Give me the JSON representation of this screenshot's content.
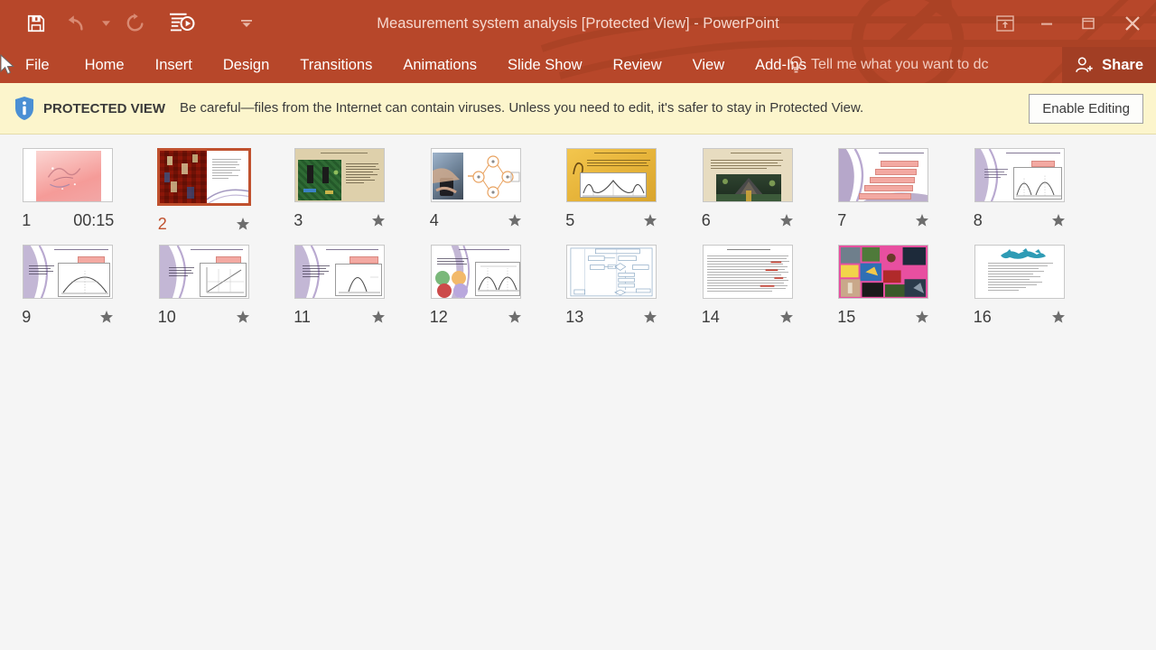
{
  "window": {
    "title": "Measurement system analysis [Protected View] - PowerPoint",
    "accent_color": "#b7472a",
    "share_label": "Share",
    "tellme_placeholder": "Tell me what you want to dc",
    "controls": [
      {
        "name": "ribbon-display-options",
        "glyph": "ribbon"
      },
      {
        "name": "minimize",
        "glyph": "minimize"
      },
      {
        "name": "restore",
        "glyph": "restore"
      },
      {
        "name": "close",
        "glyph": "close"
      }
    ]
  },
  "quick_access": [
    {
      "name": "save",
      "icon": "save-icon"
    },
    {
      "name": "undo",
      "icon": "undo-icon"
    },
    {
      "name": "undo-dropdown",
      "icon": "chevron-down-icon"
    },
    {
      "name": "redo",
      "icon": "redo-icon"
    },
    {
      "name": "start-from-beginning",
      "icon": "slideshow-icon"
    },
    {
      "name": "customize-quick-access-toolbar",
      "icon": "chevron-down-icon"
    }
  ],
  "ribbon": {
    "tabs": [
      {
        "label": "File"
      },
      {
        "label": "Home"
      },
      {
        "label": "Insert"
      },
      {
        "label": "Design"
      },
      {
        "label": "Transitions"
      },
      {
        "label": "Animations"
      },
      {
        "label": "Slide Show"
      },
      {
        "label": "Review"
      },
      {
        "label": "View"
      },
      {
        "label": "Add-Ins"
      }
    ]
  },
  "protected_view": {
    "label": "PROTECTED VIEW",
    "message": "Be careful—files from the Internet can contain viruses. Unless you need to edit, it's safer to stay in Protected View.",
    "button": "Enable Editing",
    "bar_color": "#fcf5cc",
    "icon": "info-shield-icon"
  },
  "slides": [
    {
      "number": "1",
      "timing": "00:15",
      "has_star": false,
      "selected": false,
      "style": "pink-title"
    },
    {
      "number": "2",
      "timing": "",
      "has_star": true,
      "selected": true,
      "style": "red-green-photo"
    },
    {
      "number": "3",
      "timing": "",
      "has_star": true,
      "selected": false,
      "style": "circuit-tan"
    },
    {
      "number": "4",
      "timing": "",
      "has_star": true,
      "selected": false,
      "style": "hands-diagram"
    },
    {
      "number": "5",
      "timing": "",
      "has_star": true,
      "selected": false,
      "style": "gold-curve"
    },
    {
      "number": "6",
      "timing": "",
      "has_star": true,
      "selected": false,
      "style": "tan-landscape"
    },
    {
      "number": "7",
      "timing": "",
      "has_star": true,
      "selected": false,
      "style": "purple-stack"
    },
    {
      "number": "8",
      "timing": "",
      "has_star": true,
      "selected": false,
      "style": "purple-twocurve"
    },
    {
      "number": "9",
      "timing": "",
      "has_star": true,
      "selected": false,
      "style": "purple-curve-text"
    },
    {
      "number": "10",
      "timing": "",
      "has_star": true,
      "selected": false,
      "style": "purple-line"
    },
    {
      "number": "11",
      "timing": "",
      "has_star": true,
      "selected": false,
      "style": "purple-narrow-curve"
    },
    {
      "number": "12",
      "timing": "",
      "has_star": true,
      "selected": false,
      "style": "purple-circles"
    },
    {
      "number": "13",
      "timing": "",
      "has_star": true,
      "selected": false,
      "style": "flowchart"
    },
    {
      "number": "14",
      "timing": "",
      "has_star": true,
      "selected": false,
      "style": "dense-text"
    },
    {
      "number": "15",
      "timing": "",
      "has_star": true,
      "selected": false,
      "style": "photo-collage"
    },
    {
      "number": "16",
      "timing": "",
      "has_star": true,
      "selected": false,
      "style": "teal-burst"
    }
  ]
}
